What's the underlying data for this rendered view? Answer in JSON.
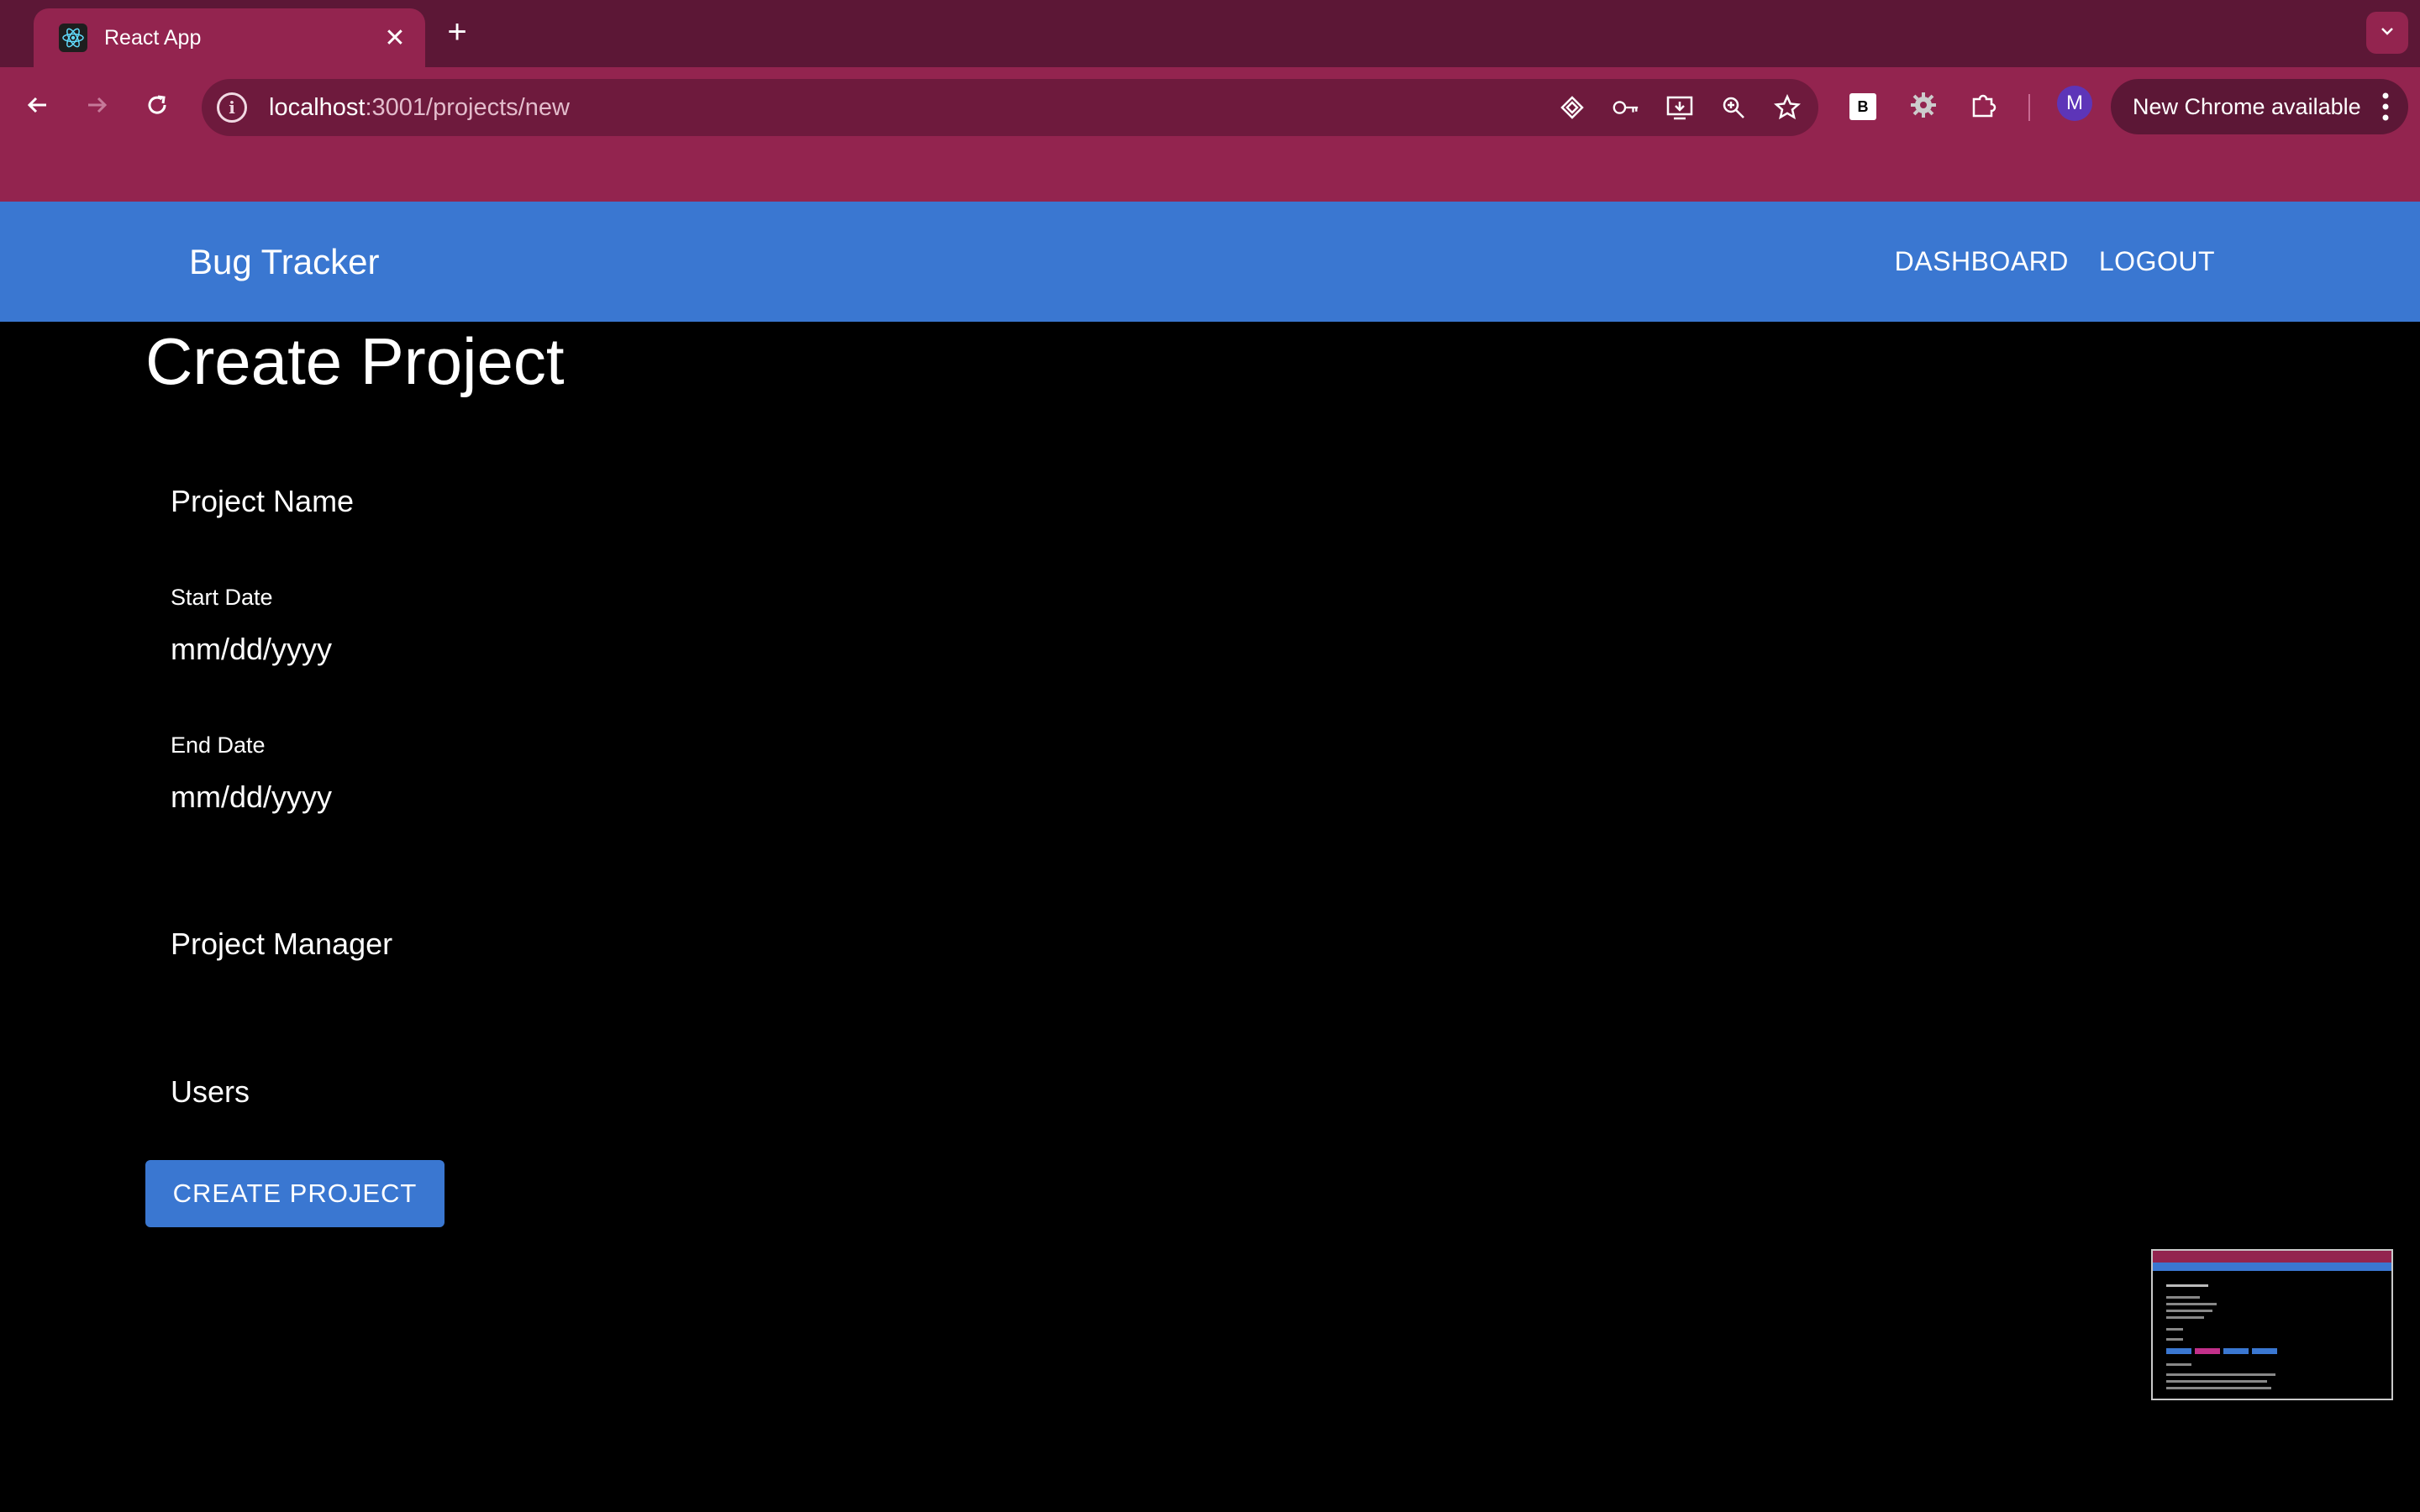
{
  "browser": {
    "tab_title": "React App",
    "tab_close": "✕",
    "new_tab": "+",
    "url_host": "localhost",
    "url_path": ":3001/projects/new",
    "profile_initial": "M",
    "extension_b_label": "B",
    "update_label": "New Chrome available"
  },
  "app": {
    "brand": "Bug Tracker",
    "nav": {
      "dashboard": "DASHBOARD",
      "logout": "LOGOUT"
    }
  },
  "form": {
    "title": "Create Project",
    "project_name_label": "Project Name",
    "start_date_label": "Start Date",
    "start_date_placeholder": "mm/dd/yyyy",
    "end_date_label": "End Date",
    "end_date_placeholder": "mm/dd/yyyy",
    "project_manager_label": "Project Manager",
    "users_label": "Users",
    "submit_label": "CREATE PROJECT"
  },
  "colors": {
    "tabstrip": "#5c1736",
    "toolbar": "#93244f",
    "appbar": "#3a77d1",
    "background": "#000000"
  }
}
